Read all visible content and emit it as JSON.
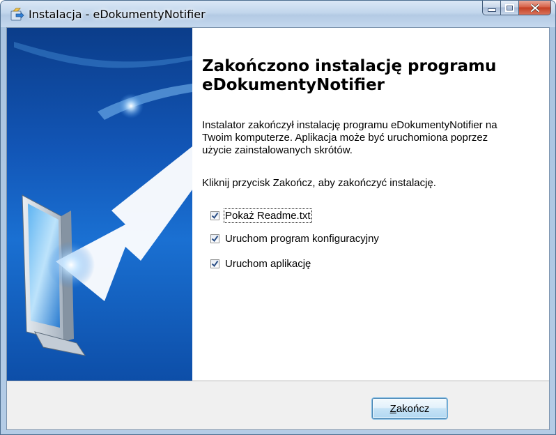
{
  "window": {
    "title": "Instalacja - eDokumentyNotifier"
  },
  "icons": {
    "app": "installer-icon",
    "minimize": "minimize-icon",
    "maximize": "maximize-icon",
    "close": "close-icon",
    "wizard_image": "monitor-arrow-illustration",
    "checkbox_check": "checkmark-icon"
  },
  "content": {
    "heading_line1": "Zakończono instalację programu",
    "heading_line2": "eDokumentyNotifier",
    "paragraph1_line1": "Instalator zakończył instalację programu eDokumentyNotifier na",
    "paragraph1_line2": "Twoim komputerze. Aplikacja może być uruchomiona poprzez",
    "paragraph1_line3": "użycie zainstalowanych skrótów.",
    "paragraph2": "Kliknij przycisk Zakończ, aby zakończyć instalację."
  },
  "options": [
    {
      "label": "Pokaż Readme.txt",
      "checked": true
    },
    {
      "label": "Uruchom program konfiguracyjny",
      "checked": true
    },
    {
      "label": "Uruchom aplikację",
      "checked": true
    }
  ],
  "footer": {
    "finish_accel": "Z",
    "finish_rest": "akończ"
  },
  "colors": {
    "side_panel": "#1256b7",
    "button_border": "#3c7fb1",
    "close_button": "#c43f23"
  }
}
